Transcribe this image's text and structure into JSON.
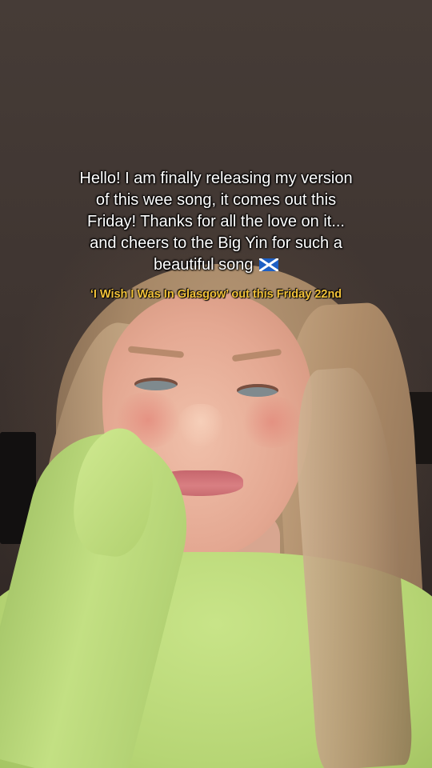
{
  "video": {
    "caption_lines": [
      "Hello! I am finally releasing my version",
      "of this wee song, it comes out this",
      "Friday! Thanks for all the love on it...",
      "and cheers to the Big Yin for such a",
      "beautiful song"
    ],
    "caption_flag": "scotland-flag-icon",
    "subcaption": "‘I Wish I Was In Glasgow’ out this Friday 22nd",
    "colors": {
      "caption_text": "#ffffff",
      "subcaption_text": "#f2c23a",
      "sweater": "#c3e083"
    }
  }
}
